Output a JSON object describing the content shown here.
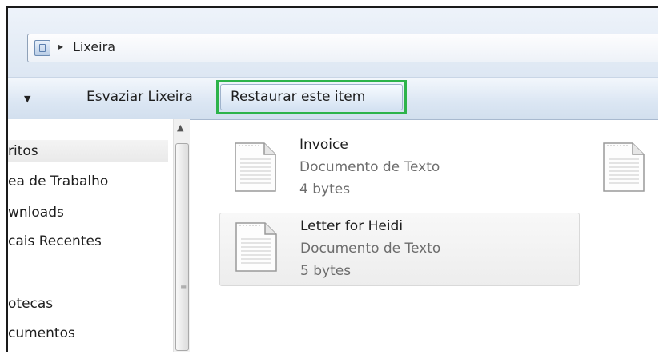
{
  "address_bar": {
    "crumb_arrow": "▸",
    "location": "Lixeira"
  },
  "toolbar": {
    "organize_caret": "▼",
    "empty_label": "Esvaziar Lixeira",
    "restore_label": "Restaurar este item",
    "highlight_color": "#2db34a"
  },
  "nav": {
    "items": [
      {
        "label": "ritos"
      },
      {
        "label": "ea de Trabalho"
      },
      {
        "label": "wnloads"
      },
      {
        "label": "cais Recentes"
      },
      {
        "label": "otecas"
      },
      {
        "label": "cumentos"
      }
    ],
    "scroll_up": "▲",
    "grip": "≡"
  },
  "files": [
    {
      "name": "Invoice",
      "type": "Documento de Texto",
      "size": "4 bytes"
    },
    {
      "name": "Letter for Heidi",
      "type": "Documento de Texto",
      "size": "5 bytes"
    }
  ]
}
